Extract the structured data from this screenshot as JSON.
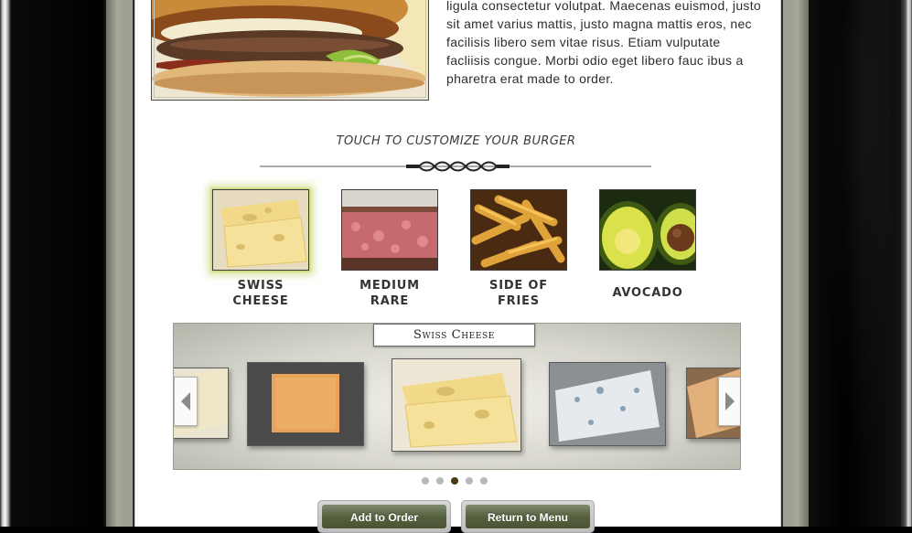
{
  "menu_item": {
    "description": "ligula consectetur volutpat. Maecenas euismod, justo sit amet varius mattis, justo magna mattis eros, nec facilisis libero sem vitae risus. Etiam vulputate facliisis congue. Morbi odio eget libero fauc ibus a pharetra erat made to order."
  },
  "customize": {
    "heading": "TOUCH TO CUSTOMIZE YOUR BURGER",
    "options": [
      {
        "line1": "SWISS",
        "line2": "CHEESE",
        "selected": true
      },
      {
        "line1": "MEDIUM",
        "line2": "RARE",
        "selected": false
      },
      {
        "line1": "SIDE OF",
        "line2": "FRIES",
        "selected": false
      },
      {
        "line1": "AVOCADO",
        "line2": "",
        "selected": false
      }
    ]
  },
  "carousel": {
    "title": "Swiss Cheese",
    "page_count": 5,
    "active_page": 3
  },
  "buttons": {
    "add_to_order": "Add to Order",
    "return_to_menu": "Return to Menu"
  },
  "colors": {
    "selection_glow": "#c9d97a",
    "button_green": "#56613f",
    "active_dot": "#4a3a10"
  }
}
